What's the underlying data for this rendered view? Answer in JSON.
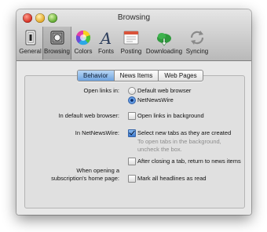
{
  "window": {
    "title": "Browsing"
  },
  "toolbar": {
    "items": [
      {
        "label": "General",
        "icon": "general-icon"
      },
      {
        "label": "Browsing",
        "icon": "browsing-icon",
        "selected": true
      },
      {
        "label": "Colors",
        "icon": "colors-icon"
      },
      {
        "label": "Fonts",
        "icon": "fonts-icon"
      },
      {
        "label": "Posting",
        "icon": "posting-icon"
      },
      {
        "label": "Downloading",
        "icon": "downloading-icon"
      },
      {
        "label": "Syncing",
        "icon": "syncing-icon"
      }
    ]
  },
  "tabs": [
    {
      "label": "Behavior",
      "active": true
    },
    {
      "label": "News Items",
      "active": false
    },
    {
      "label": "Web Pages",
      "active": false
    }
  ],
  "settings": {
    "open_links": {
      "label": "Open links in:",
      "options": [
        {
          "label": "Default web browser",
          "selected": false
        },
        {
          "label": "NetNewsWire",
          "selected": true
        }
      ]
    },
    "default_browser": {
      "label": "In default web browser:",
      "option": {
        "label": "Open links in background",
        "checked": false
      }
    },
    "netnewswire": {
      "label": "In NetNewsWire:",
      "select_tabs": {
        "label": "Select new tabs as they are created",
        "checked": true
      },
      "hint_line1": "To open tabs in the background,",
      "hint_line2": "uncheck the box.",
      "return_to_news": {
        "label": "After closing a tab, return to news items",
        "checked": false
      }
    },
    "home_page": {
      "label_line1": "When opening a",
      "label_line2": "subscription's home page:",
      "option": {
        "label": "Mark all headlines as read",
        "checked": false
      }
    }
  }
}
